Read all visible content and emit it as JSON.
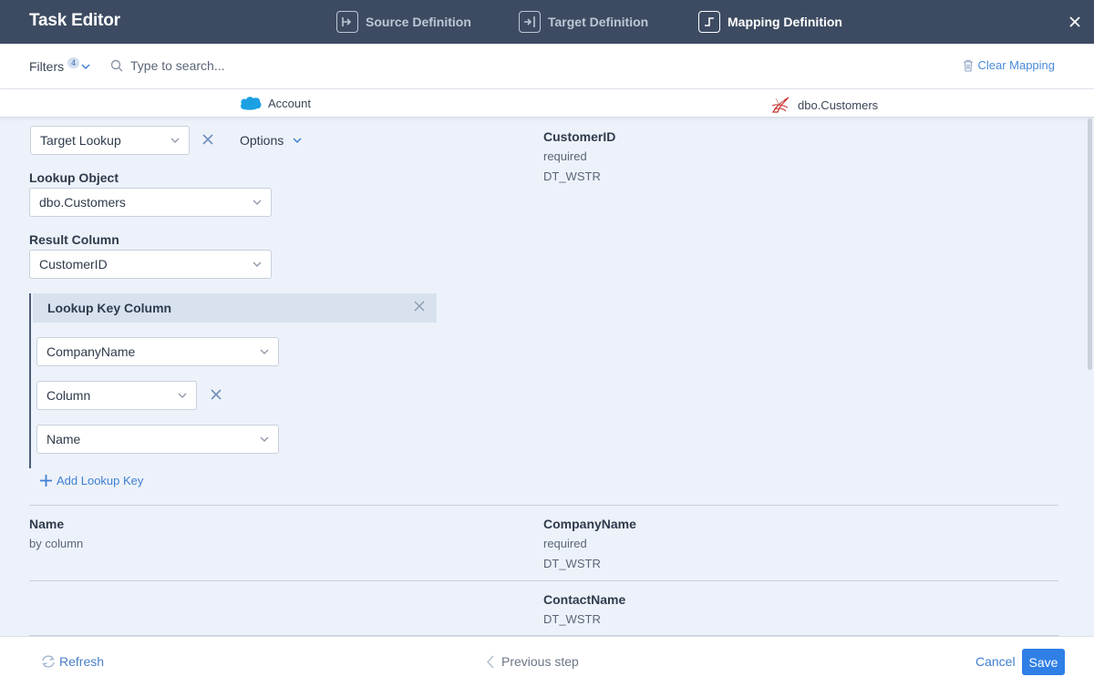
{
  "header": {
    "title": "Task Editor",
    "steps": [
      {
        "label": "Source Definition"
      },
      {
        "label": "Target Definition"
      },
      {
        "label": "Mapping Definition"
      }
    ]
  },
  "toolbar": {
    "filters_label": "Filters",
    "filters_count": "4",
    "search_placeholder": "Type to search...",
    "clear_mapping_label": "Clear Mapping"
  },
  "objects": {
    "source": "Account",
    "target": "dbo.Customers"
  },
  "mapping": {
    "type_select": "Target Lookup",
    "options_label": "Options",
    "lookup_object_label": "Lookup Object",
    "lookup_object_value": "dbo.Customers",
    "result_column_label": "Result Column",
    "result_column_value": "CustomerID",
    "lookup_key_title": "Lookup Key Column",
    "key_column_value": "CompanyName",
    "key_type_value": "Column",
    "key_source_value": "Name",
    "add_key_label": "Add Lookup Key"
  },
  "targets": [
    {
      "name": "CustomerID",
      "line1": "required",
      "line2": "DT_WSTR"
    },
    {
      "name": "CompanyName",
      "line1": "required",
      "line2": "DT_WSTR"
    },
    {
      "name": "ContactName",
      "line1": "DT_WSTR"
    }
  ],
  "sources": [
    {
      "name": "Name",
      "detail": "by column"
    }
  ],
  "footer": {
    "refresh_label": "Refresh",
    "prev_label": "Previous step",
    "cancel_label": "Cancel",
    "save_label": "Save"
  }
}
